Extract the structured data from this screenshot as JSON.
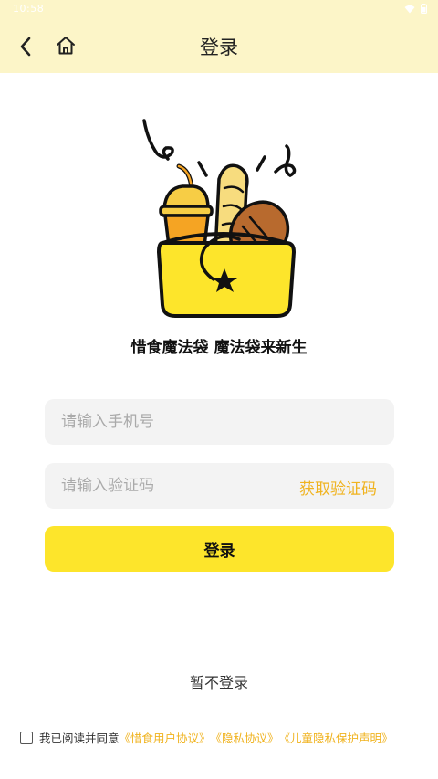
{
  "status_bar": {
    "time": "10:58"
  },
  "header": {
    "title": "登录",
    "back_icon": "chevron-left-icon",
    "home_icon": "home-icon",
    "background": "#fcf5c8"
  },
  "slogan": "惜食魔法袋  魔法袋来新生",
  "form": {
    "phone_placeholder": "请输入手机号",
    "phone_value": "",
    "code_placeholder": "请输入验证码",
    "code_value": "",
    "get_code_label": "获取验证码",
    "login_label": "登录"
  },
  "skip_label": "暂不登录",
  "agreement": {
    "checked": false,
    "text": "我已阅读并同意",
    "links": [
      "《惜食用户协议》",
      "《隐私协议》",
      "《儿童隐私保护声明》"
    ]
  },
  "colors": {
    "accent": "#fde52b",
    "link": "#f0b31f",
    "input_bg": "#f3f3f3"
  }
}
